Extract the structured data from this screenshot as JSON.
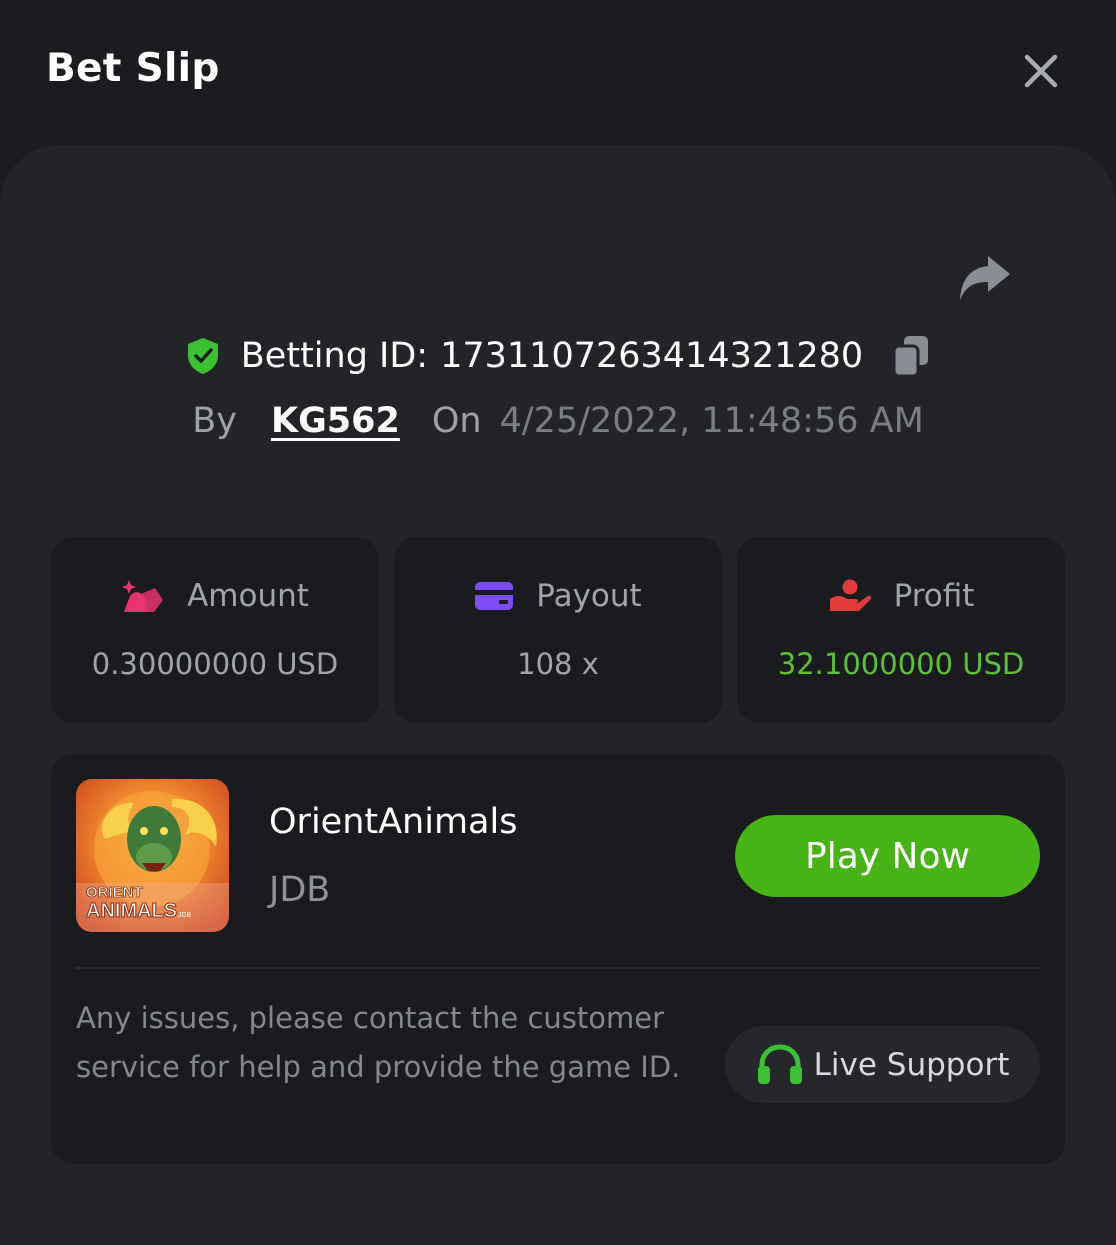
{
  "header": {
    "title": "Bet Slip"
  },
  "bet": {
    "id_label": "Betting ID:",
    "id_value": "1731107263414321280",
    "by_label": "By",
    "user": "KG562",
    "on_label": "On",
    "datetime": "4/25/2022, 11:48:56 AM"
  },
  "stats": {
    "amount": {
      "label": "Amount",
      "value": "0.30000000 USD",
      "icon": "money-bag-icon",
      "color": "#e8336e"
    },
    "payout": {
      "label": "Payout",
      "value": "108 x",
      "icon": "credit-card-icon",
      "color": "#7b4df2"
    },
    "profit": {
      "label": "Profit",
      "value": "32.1000000 USD",
      "icon": "hand-coin-icon",
      "color": "#e23b3b"
    }
  },
  "game": {
    "name": "OrientAnimals",
    "provider": "JDB",
    "thumb_line1": "ORIENT",
    "thumb_line2": "ANIMALS",
    "thumb_tag": "JDB",
    "play_label": "Play Now"
  },
  "support": {
    "help_text": "Any issues, please contact the customer service for help and provide the game ID.",
    "button_label": "Live Support",
    "icon": "headset-icon"
  },
  "colors": {
    "accent_green": "#46b414",
    "profit_green": "#5cc233",
    "background": "#1b1c1f",
    "card": "#232427",
    "panel": "#1a1b1e"
  }
}
